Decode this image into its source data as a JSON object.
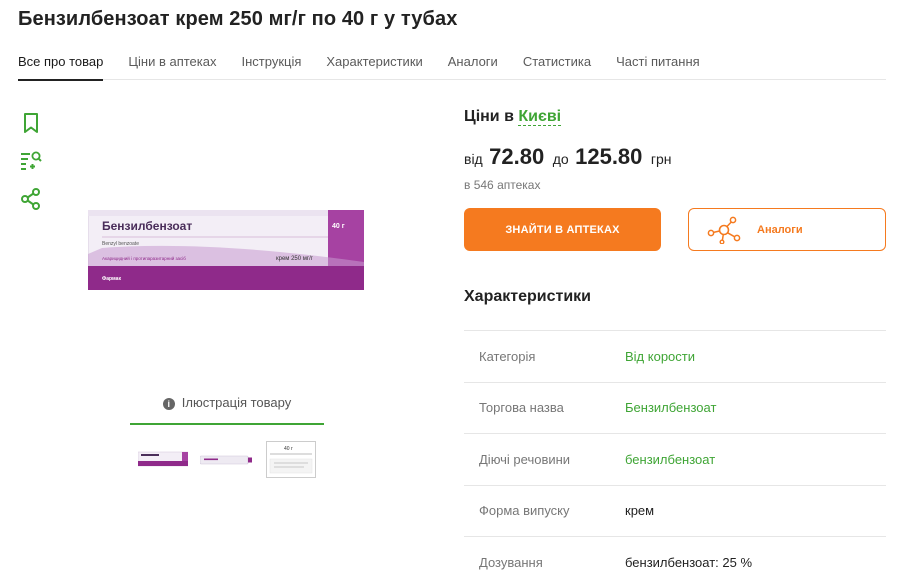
{
  "page": {
    "title": "Бензилбензоат крем 250 мг/г по 40 г у тубах"
  },
  "tabs": [
    {
      "label": "Все про товар",
      "active": true
    },
    {
      "label": "Ціни в аптеках"
    },
    {
      "label": "Інструкція"
    },
    {
      "label": "Характеристики"
    },
    {
      "label": "Аналоги"
    },
    {
      "label": "Статистика"
    },
    {
      "label": "Часті питання"
    }
  ],
  "side_actions": [
    "bookmark-icon",
    "add-to-list-icon",
    "share-icon"
  ],
  "product_box": {
    "name": "Бензилбензоат",
    "latin": "Benzyl benzoate",
    "weight": "40 г",
    "description": "Акарицидний і протипаразитарний засіб",
    "dose": "крем 250 мг/г",
    "maker": "Фармак"
  },
  "gallery": {
    "caption": "Ілюстрація товару",
    "thumb_3_text": "40 г"
  },
  "prices": {
    "heading_prefix": "Ціни в",
    "city": "Києві",
    "from_label": "від",
    "min": "72.80",
    "to_label": "до",
    "max": "125.80",
    "currency": "грн",
    "pharmacies": "в 546 аптеках"
  },
  "buttons": {
    "find": "ЗНАЙТИ В АПТЕКАХ",
    "analogs": "Аналоги"
  },
  "characteristics": {
    "heading": "Характеристики",
    "rows": [
      {
        "key": "Категорія",
        "value": "Від корости",
        "link": true
      },
      {
        "key": "Торгова назва",
        "value": "Бензилбензоат",
        "link": true
      },
      {
        "key": "Діючі речовини",
        "value": "бензилбензоат",
        "link": true
      },
      {
        "key": "Форма випуску",
        "value": "крем",
        "link": false
      },
      {
        "key": "Дозування",
        "value": "бензилбензоат: 25 %",
        "link": false
      }
    ]
  },
  "colors": {
    "accent_green": "#3fa535",
    "accent_orange": "#f57a1f",
    "box_purple": "#8f2a8a"
  }
}
